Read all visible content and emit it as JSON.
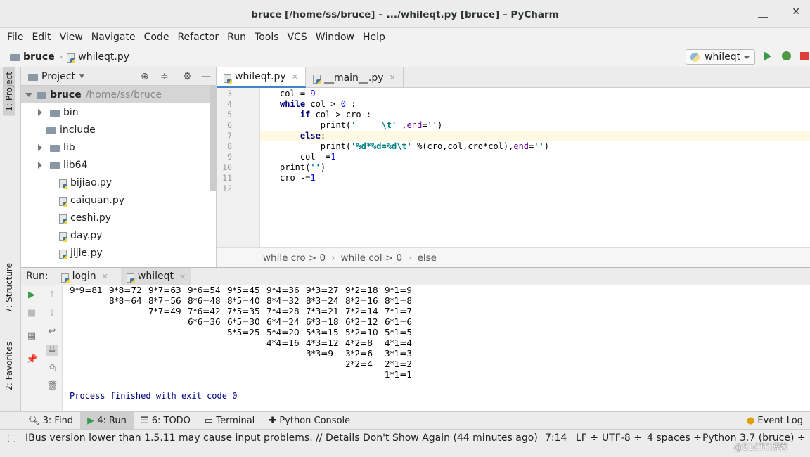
{
  "window": {
    "title": "bruce [/home/ss/bruce] – .../whileqt.py [bruce] – PyCharm"
  },
  "menu": [
    "File",
    "Edit",
    "View",
    "Navigate",
    "Code",
    "Refactor",
    "Run",
    "Tools",
    "VCS",
    "Window",
    "Help"
  ],
  "nav": {
    "project": "bruce",
    "file": "whileqt.py",
    "run_config": "whileqt"
  },
  "sidebar": {
    "project_tab": "1: Project",
    "structure_tab": "7: Structure",
    "favorites_tab": "2: Favorites"
  },
  "project": {
    "header": "Project",
    "root": "bruce",
    "root_path": "/home/ss/bruce",
    "items": [
      {
        "label": "bin",
        "type": "folder"
      },
      {
        "label": "include",
        "type": "folder"
      },
      {
        "label": "lib",
        "type": "folder"
      },
      {
        "label": "lib64",
        "type": "folder"
      },
      {
        "label": "bijiao.py",
        "type": "file"
      },
      {
        "label": "caiquan.py",
        "type": "file"
      },
      {
        "label": "ceshi.py",
        "type": "file"
      },
      {
        "label": "day.py",
        "type": "file"
      },
      {
        "label": "jijie.py",
        "type": "file"
      }
    ]
  },
  "editor": {
    "tabs": [
      "whileqt.py",
      "__main__.py"
    ],
    "line_numbers": [
      "3",
      "4",
      "5",
      "6",
      "7",
      "8",
      "9",
      "10",
      "11",
      "12"
    ],
    "breadcrumb": [
      "while cro > 0",
      "while col > 0",
      "else"
    ]
  },
  "run": {
    "label": "Run:",
    "tabs": [
      "login",
      "whileqt"
    ],
    "output": [
      [
        "9*9=81",
        "9*8=72",
        "9*7=63",
        "9*6=54",
        "9*5=45",
        "9*4=36",
        "9*3=27",
        "9*2=18",
        "9*1=9"
      ],
      [
        "",
        "8*8=64",
        "8*7=56",
        "8*6=48",
        "8*5=40",
        "8*4=32",
        "8*3=24",
        "8*2=16",
        "8*1=8"
      ],
      [
        "",
        "",
        "7*7=49",
        "7*6=42",
        "7*5=35",
        "7*4=28",
        "7*3=21",
        "7*2=14",
        "7*1=7"
      ],
      [
        "",
        "",
        "",
        "6*6=36",
        "6*5=30",
        "6*4=24",
        "6*3=18",
        "6*2=12",
        "6*1=6"
      ],
      [
        "",
        "",
        "",
        "",
        "5*5=25",
        "5*4=20",
        "5*3=15",
        "5*2=10",
        "5*1=5"
      ],
      [
        "",
        "",
        "",
        "",
        "",
        "4*4=16",
        "4*3=12",
        "4*2=8",
        "4*1=4"
      ],
      [
        "",
        "",
        "",
        "",
        "",
        "",
        "3*3=9",
        "3*2=6",
        "3*1=3"
      ],
      [
        "",
        "",
        "",
        "",
        "",
        "",
        "",
        "2*2=4",
        "2*1=2"
      ],
      [
        "",
        "",
        "",
        "",
        "",
        "",
        "",
        "",
        "1*1=1"
      ]
    ],
    "process_message": "Process finished with exit code 0"
  },
  "tool_tabs": [
    "3: Find",
    "4: Run",
    "6: TODO",
    "Terminal",
    "Python Console",
    "Event Log"
  ],
  "status": {
    "message": "IBus version lower than 1.5.11 may cause input problems. // Details Don't Show Again (44 minutes ago)",
    "position": "7:14",
    "line_sep": "LF ÷",
    "encoding": "UTF-8 ÷",
    "indent": "4 spaces ÷",
    "interpreter": "Python 3.7 (bruce) ÷",
    "watermark": "@51CTO博客"
  },
  "colors": {
    "accent": "#4083c9",
    "run": "#3a9c48",
    "stop": "#e0403c",
    "keyword": "#000080",
    "string": "#008080"
  }
}
